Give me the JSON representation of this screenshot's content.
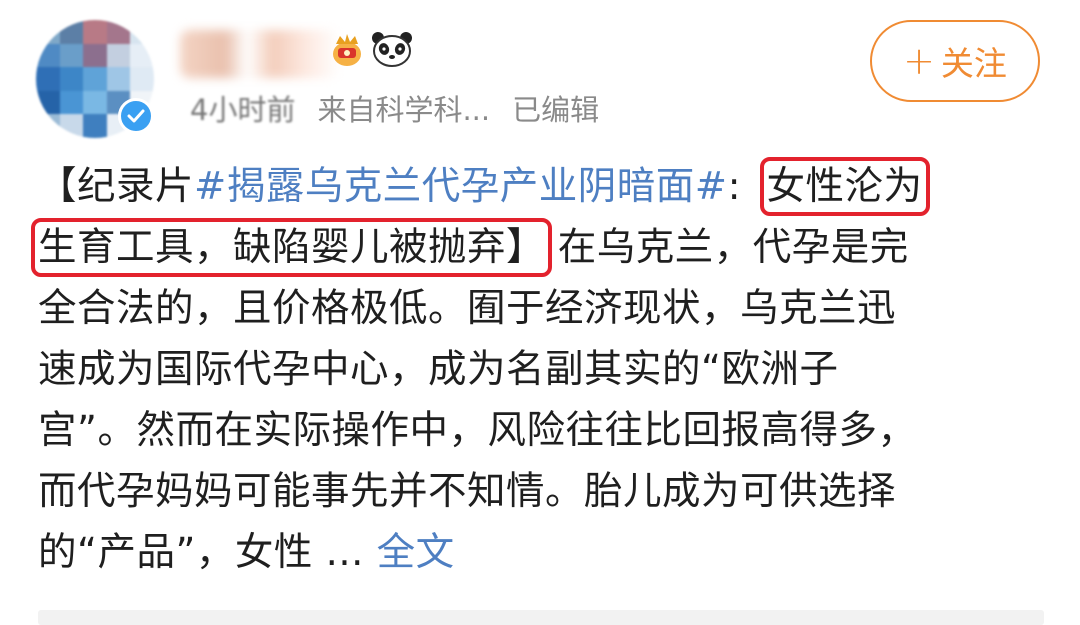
{
  "header": {
    "meta_time": "4小时前",
    "meta_source": "来自科学科...",
    "meta_edited": "已编辑",
    "follow_plus": "+",
    "follow_label": "关注"
  },
  "post": {
    "open_bracket": "【",
    "doc_prefix": "纪录片",
    "hashtag": "#揭露乌克兰代孕产业阴暗面#",
    "colon": ":",
    "headline_part1": "女性沦为",
    "headline_part2": "生育工具，缺陷婴儿被抛弃】",
    "line2_rest": "在乌克兰，代孕是完",
    "line3": "全合法的，且价格极低。囿于经济现状，乌克兰迅",
    "line4": "速成为国际代孕中心，成为名副其实的“欧洲子",
    "line5": "宫”。然而在实际操作中，风险往往比回报高得多，",
    "line6": "而代孕妈妈可能事先并不知情。胎儿成为可供选择",
    "line7": "的“产品”，女性 ...",
    "expand_label": "全文"
  },
  "colors": {
    "accent_orange": "#f08b33",
    "link_blue": "#4e7fc2",
    "highlight_red": "#e3222d",
    "verified_blue": "#3aa0f2"
  },
  "icons": [
    "verified-icon",
    "crown-icon",
    "panda-icon"
  ]
}
